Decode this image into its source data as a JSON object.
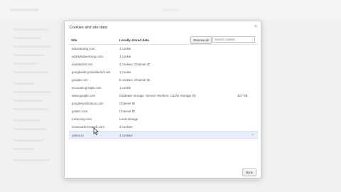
{
  "dialog": {
    "title": "Cookies and site data",
    "close_label": "×",
    "columns": {
      "site": "Site",
      "data": "Locally stored data"
    },
    "remove_all_label": "Remove all",
    "search_placeholder": "Search cookies",
    "done_label": "Done",
    "rows": [
      {
        "site": "adcentering.com",
        "data": "1 cookie",
        "size": ""
      },
      {
        "site": "adsbyhadvertsing.com",
        "data": "1 cookie",
        "size": ""
      },
      {
        "site": "doubleclick.net",
        "data": "3 cookies, Channel ID",
        "size": ""
      },
      {
        "site": "googleads.g.doubleclick.net",
        "data": "1 cookie",
        "size": ""
      },
      {
        "site": "google.com",
        "data": "5 cookies, Channel ID",
        "size": ""
      },
      {
        "site": "accounts.google.com",
        "data": "1 cookie",
        "size": ""
      },
      {
        "site": "www.google.com",
        "data": "Database storage, Service Workers, Cache Storage (3)",
        "size": "327 KB"
      },
      {
        "site": "googlesyndication.com",
        "data": "Channel ID",
        "size": ""
      },
      {
        "site": "gstatic.com",
        "data": "Channel ID",
        "size": ""
      },
      {
        "site": "mizeresty.com",
        "data": "Local storage",
        "size": ""
      },
      {
        "site": "scorecardresearch.com",
        "data": "2 cookies",
        "size": ""
      },
      {
        "site": "yahoo.io",
        "data": "2 cookies",
        "size": "",
        "selected": true
      }
    ],
    "row_remove_label": "×"
  }
}
